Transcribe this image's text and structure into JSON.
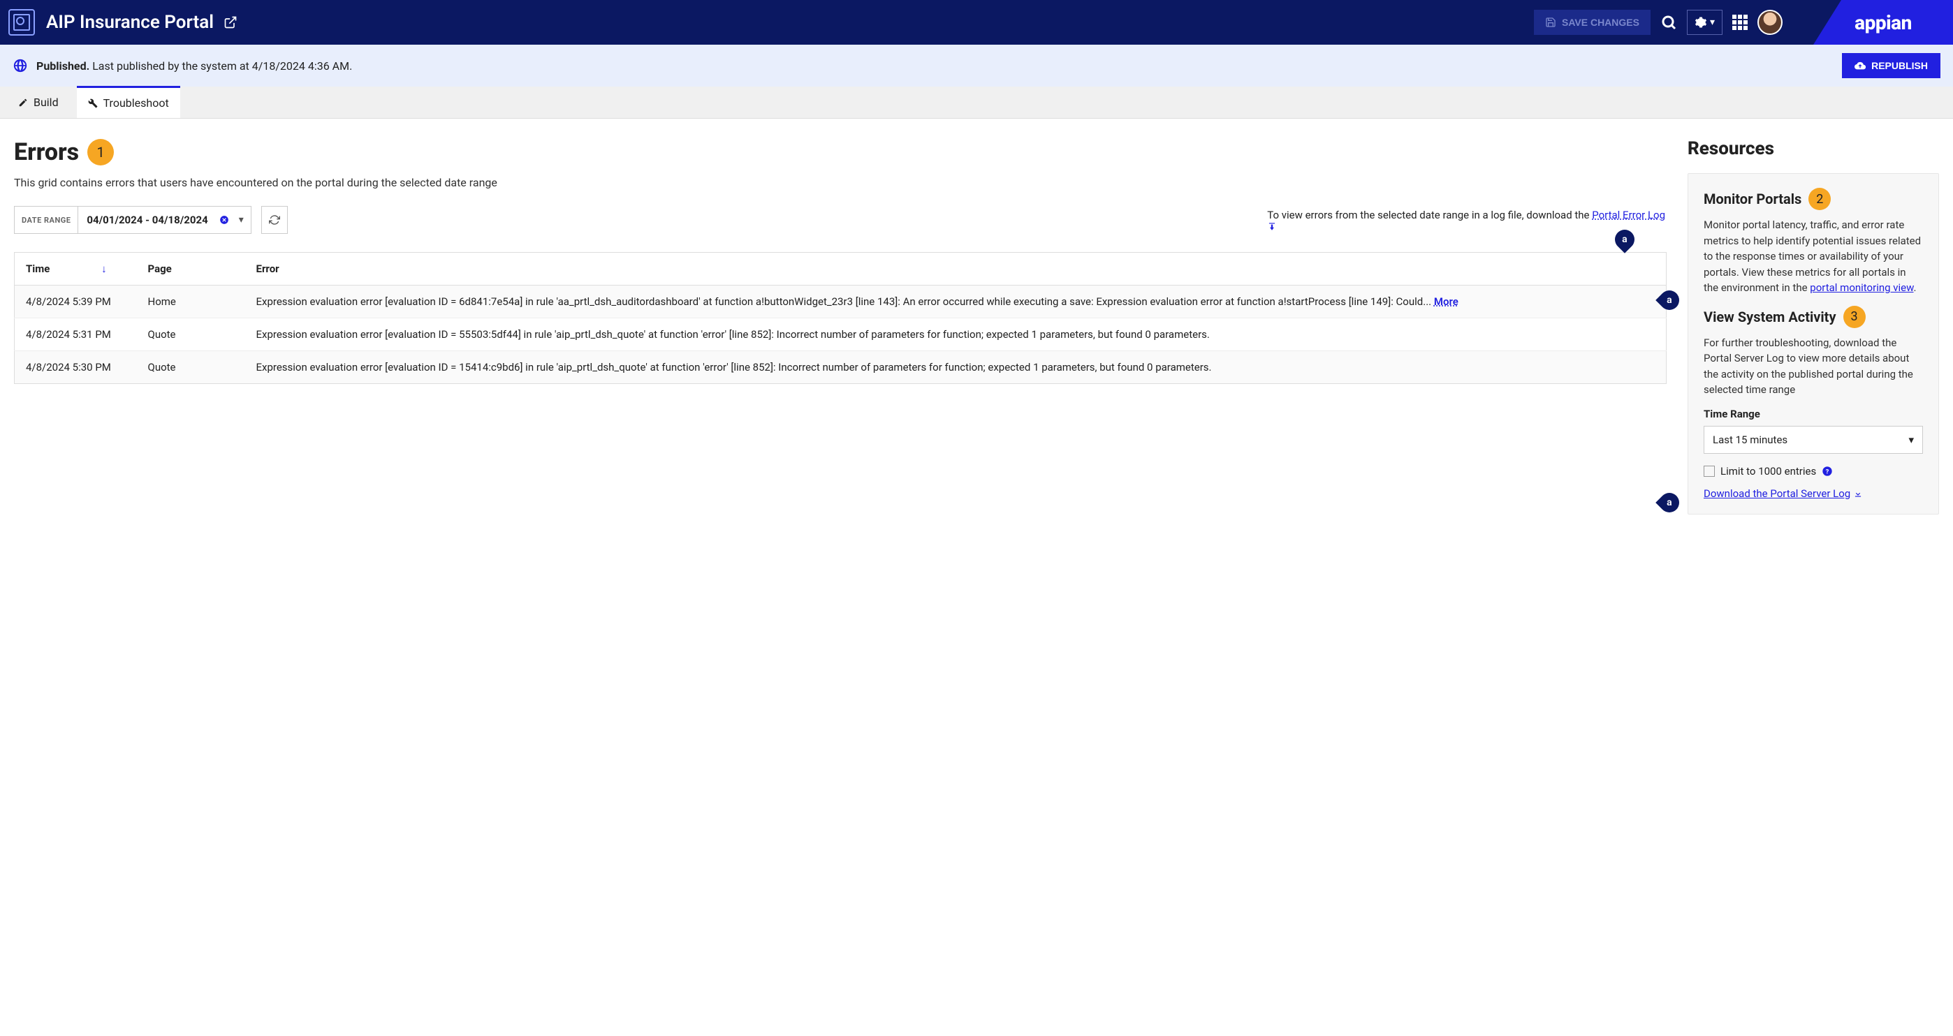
{
  "header": {
    "app_title": "AIP Insurance Portal",
    "save_label": "SAVE CHANGES",
    "brand": "appian"
  },
  "status": {
    "prefix": "Published.",
    "text": "Last published by the system at 4/18/2024 4:36 AM.",
    "republish": "REPUBLISH"
  },
  "tabs": {
    "build": "Build",
    "troubleshoot": "Troubleshoot"
  },
  "errors": {
    "title": "Errors",
    "badge": "1",
    "desc": "This grid contains errors that users have encountered on the portal during the selected date range",
    "date_label": "DATE RANGE",
    "date_value": "04/01/2024 - 04/18/2024",
    "hint_prefix": "To view errors from the selected date range in a log file, download the ",
    "hint_link": "Portal Error Log",
    "columns": {
      "time": "Time",
      "page": "Page",
      "error": "Error"
    },
    "rows": [
      {
        "time": "4/8/2024 5:39 PM",
        "page": "Home",
        "error": "Expression evaluation error [evaluation ID = 6d841:7e54a] in rule 'aa_prtl_dsh_auditordashboard' at function a!buttonWidget_23r3 [line 143]: An error occurred while executing a save: Expression evaluation error at function a!startProcess [line 149]: Could... ",
        "more": "More"
      },
      {
        "time": "4/8/2024 5:31 PM",
        "page": "Quote",
        "error": "Expression evaluation error [evaluation ID = 55503:5df44] in rule 'aip_prtl_dsh_quote' at function 'error' [line 852]: Incorrect number of parameters for function; expected 1 parameters, but found 0 parameters.",
        "more": ""
      },
      {
        "time": "4/8/2024 5:30 PM",
        "page": "Quote",
        "error": "Expression evaluation error [evaluation ID = 15414:c9bd6] in rule 'aip_prtl_dsh_quote' at function 'error' [line 852]: Incorrect number of parameters for function; expected 1 parameters, but found 0 parameters.",
        "more": ""
      }
    ]
  },
  "resources": {
    "title": "Resources",
    "monitor_h": "Monitor Portals",
    "monitor_badge": "2",
    "monitor_p_pre": "Monitor portal latency, traffic, and error rate metrics to help identify potential issues related to the response times or availability of your portals. View these metrics for all portals in the environment in the ",
    "monitor_link": "portal monitoring view",
    "monitor_p_post": ".",
    "activity_h": "View System Activity",
    "activity_badge": "3",
    "activity_p": "For further troubleshooting, download the Portal Server Log to view more details about the activity on the published portal during the selected time range",
    "timerange_label": "Time Range",
    "timerange_value": "Last 15 minutes",
    "limit_label": "Limit to 1000 entries",
    "download_link": "Download the Portal Server Log"
  },
  "markers": {
    "a": "a"
  }
}
